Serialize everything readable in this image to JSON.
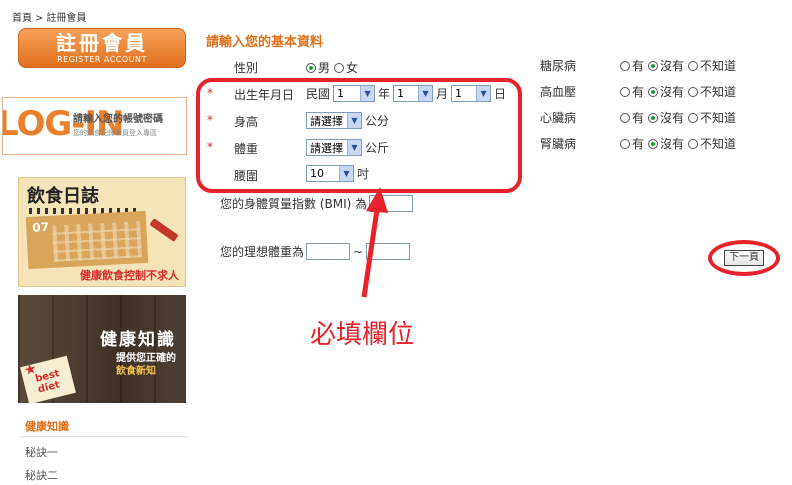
{
  "breadcrumb": {
    "home": "首頁",
    "separator": ">",
    "current": "註冊會員"
  },
  "sidebar": {
    "register": {
      "main": "註冊會員",
      "sub": "REGISTER ACCOUNT"
    },
    "login": {
      "logo": "LOG-IN",
      "line1": "請輸入您的帳號密碼",
      "line2": "您的飲食記錄會員登入專區"
    },
    "diet_diary": {
      "title": "飲食日誌",
      "calendar_num": "07",
      "tagline": "健康飲食控制不求人"
    },
    "health_knowledge": {
      "title": "健康知識",
      "line1": "提供您正確的",
      "line2": "飲食新知",
      "note_text": "best diet"
    },
    "section_heading": "健康知識",
    "links": [
      "秘訣一",
      "秘訣二"
    ]
  },
  "form": {
    "title": "請輸入您的基本資料",
    "required_mark": "*",
    "gender": {
      "label": "性別",
      "options": [
        "男",
        "女"
      ],
      "selected": "男"
    },
    "birthday": {
      "label": "出生年月日",
      "era": "民國",
      "year_value": "1",
      "year_unit": "年",
      "month_value": "1",
      "month_unit": "月",
      "day_value": "1",
      "day_unit": "日"
    },
    "height": {
      "label": "身高",
      "select_value": "請選擇",
      "unit": "公分"
    },
    "weight": {
      "label": "體重",
      "select_value": "請選擇",
      "unit": "公斤"
    },
    "waist": {
      "label": "腰圍",
      "select_value": "10",
      "unit": "吋"
    },
    "bmi": {
      "label": "您的身體質量指數 (BMI) 為",
      "value": ""
    },
    "ideal_weight": {
      "label": "您的理想體重為",
      "separator": "~",
      "min": "",
      "max": ""
    },
    "next_button": "下一頁"
  },
  "health_questions": {
    "options": [
      "有",
      "沒有",
      "不知道"
    ],
    "items": [
      {
        "label": "糖尿病",
        "selected": "沒有"
      },
      {
        "label": "高血壓",
        "selected": "沒有"
      },
      {
        "label": "心臟病",
        "selected": "沒有"
      },
      {
        "label": "腎臟病",
        "selected": "沒有"
      }
    ]
  },
  "annotation": {
    "text": "必填欄位"
  },
  "colors": {
    "accent": "#e0701c",
    "annotation": "#e8222a",
    "radio_selected": "#1a9c3e"
  }
}
